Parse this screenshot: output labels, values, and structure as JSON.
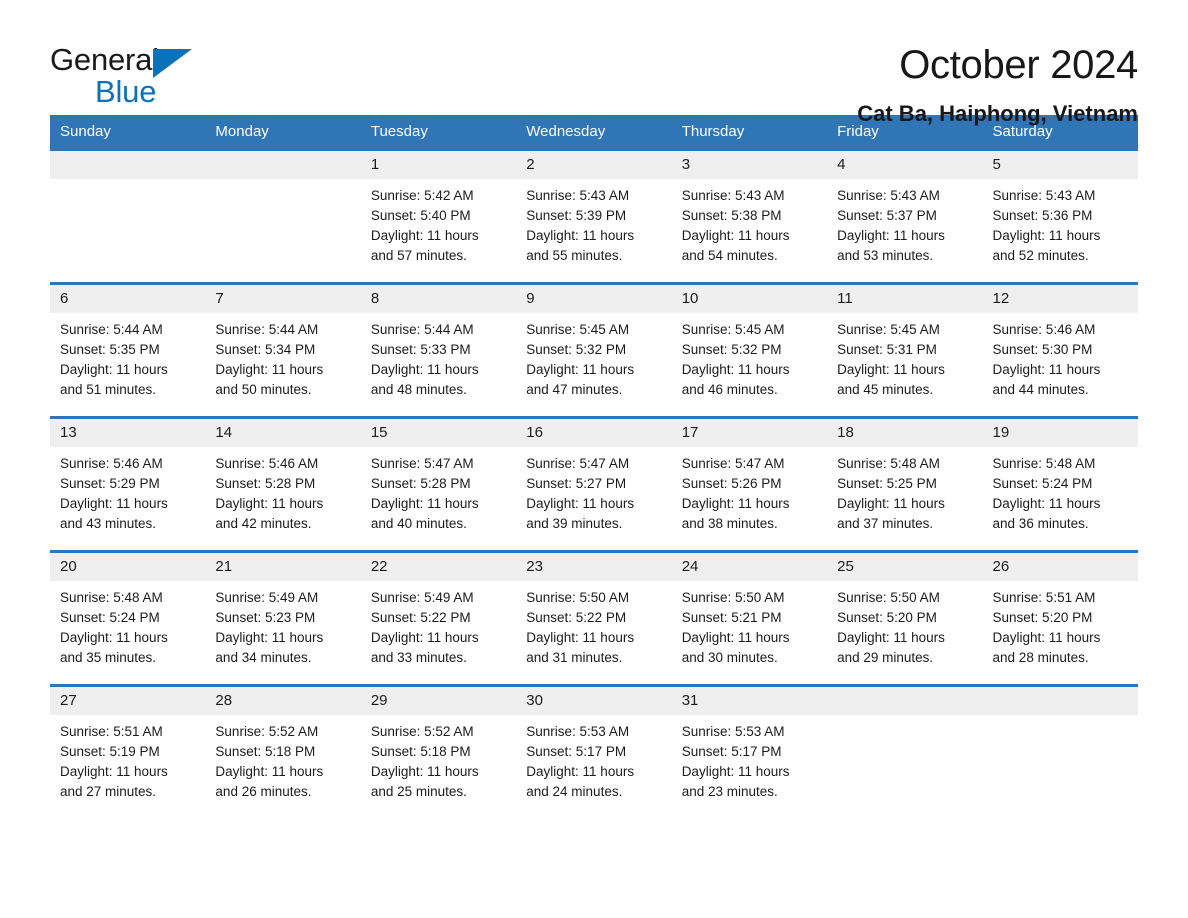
{
  "brand": {
    "word_one": "General",
    "word_two": "Blue",
    "triangle_icon": "brand-triangle-icon",
    "accent_color": "#0b72ba"
  },
  "header": {
    "month_title": "October 2024",
    "location": "Cat Ba, Haiphong, Vietnam"
  },
  "theme": {
    "header_blue": "#3075b5",
    "row_rule_blue": "#2f74b4",
    "day_band_gray": "#efefef",
    "text_color": "#1c1c1c"
  },
  "calendar": {
    "weekday_headers": [
      "Sunday",
      "Monday",
      "Tuesday",
      "Wednesday",
      "Thursday",
      "Friday",
      "Saturday"
    ],
    "weeks": [
      [
        {
          "day": "",
          "detail": ""
        },
        {
          "day": "",
          "detail": ""
        },
        {
          "day": "1",
          "detail": "Sunrise: 5:42 AM\nSunset: 5:40 PM\nDaylight: 11 hours\nand 57 minutes."
        },
        {
          "day": "2",
          "detail": "Sunrise: 5:43 AM\nSunset: 5:39 PM\nDaylight: 11 hours\nand 55 minutes."
        },
        {
          "day": "3",
          "detail": "Sunrise: 5:43 AM\nSunset: 5:38 PM\nDaylight: 11 hours\nand 54 minutes."
        },
        {
          "day": "4",
          "detail": "Sunrise: 5:43 AM\nSunset: 5:37 PM\nDaylight: 11 hours\nand 53 minutes."
        },
        {
          "day": "5",
          "detail": "Sunrise: 5:43 AM\nSunset: 5:36 PM\nDaylight: 11 hours\nand 52 minutes."
        }
      ],
      [
        {
          "day": "6",
          "detail": "Sunrise: 5:44 AM\nSunset: 5:35 PM\nDaylight: 11 hours\nand 51 minutes."
        },
        {
          "day": "7",
          "detail": "Sunrise: 5:44 AM\nSunset: 5:34 PM\nDaylight: 11 hours\nand 50 minutes."
        },
        {
          "day": "8",
          "detail": "Sunrise: 5:44 AM\nSunset: 5:33 PM\nDaylight: 11 hours\nand 48 minutes."
        },
        {
          "day": "9",
          "detail": "Sunrise: 5:45 AM\nSunset: 5:32 PM\nDaylight: 11 hours\nand 47 minutes."
        },
        {
          "day": "10",
          "detail": "Sunrise: 5:45 AM\nSunset: 5:32 PM\nDaylight: 11 hours\nand 46 minutes."
        },
        {
          "day": "11",
          "detail": "Sunrise: 5:45 AM\nSunset: 5:31 PM\nDaylight: 11 hours\nand 45 minutes."
        },
        {
          "day": "12",
          "detail": "Sunrise: 5:46 AM\nSunset: 5:30 PM\nDaylight: 11 hours\nand 44 minutes."
        }
      ],
      [
        {
          "day": "13",
          "detail": "Sunrise: 5:46 AM\nSunset: 5:29 PM\nDaylight: 11 hours\nand 43 minutes."
        },
        {
          "day": "14",
          "detail": "Sunrise: 5:46 AM\nSunset: 5:28 PM\nDaylight: 11 hours\nand 42 minutes."
        },
        {
          "day": "15",
          "detail": "Sunrise: 5:47 AM\nSunset: 5:28 PM\nDaylight: 11 hours\nand 40 minutes."
        },
        {
          "day": "16",
          "detail": "Sunrise: 5:47 AM\nSunset: 5:27 PM\nDaylight: 11 hours\nand 39 minutes."
        },
        {
          "day": "17",
          "detail": "Sunrise: 5:47 AM\nSunset: 5:26 PM\nDaylight: 11 hours\nand 38 minutes."
        },
        {
          "day": "18",
          "detail": "Sunrise: 5:48 AM\nSunset: 5:25 PM\nDaylight: 11 hours\nand 37 minutes."
        },
        {
          "day": "19",
          "detail": "Sunrise: 5:48 AM\nSunset: 5:24 PM\nDaylight: 11 hours\nand 36 minutes."
        }
      ],
      [
        {
          "day": "20",
          "detail": "Sunrise: 5:48 AM\nSunset: 5:24 PM\nDaylight: 11 hours\nand 35 minutes."
        },
        {
          "day": "21",
          "detail": "Sunrise: 5:49 AM\nSunset: 5:23 PM\nDaylight: 11 hours\nand 34 minutes."
        },
        {
          "day": "22",
          "detail": "Sunrise: 5:49 AM\nSunset: 5:22 PM\nDaylight: 11 hours\nand 33 minutes."
        },
        {
          "day": "23",
          "detail": "Sunrise: 5:50 AM\nSunset: 5:22 PM\nDaylight: 11 hours\nand 31 minutes."
        },
        {
          "day": "24",
          "detail": "Sunrise: 5:50 AM\nSunset: 5:21 PM\nDaylight: 11 hours\nand 30 minutes."
        },
        {
          "day": "25",
          "detail": "Sunrise: 5:50 AM\nSunset: 5:20 PM\nDaylight: 11 hours\nand 29 minutes."
        },
        {
          "day": "26",
          "detail": "Sunrise: 5:51 AM\nSunset: 5:20 PM\nDaylight: 11 hours\nand 28 minutes."
        }
      ],
      [
        {
          "day": "27",
          "detail": "Sunrise: 5:51 AM\nSunset: 5:19 PM\nDaylight: 11 hours\nand 27 minutes."
        },
        {
          "day": "28",
          "detail": "Sunrise: 5:52 AM\nSunset: 5:18 PM\nDaylight: 11 hours\nand 26 minutes."
        },
        {
          "day": "29",
          "detail": "Sunrise: 5:52 AM\nSunset: 5:18 PM\nDaylight: 11 hours\nand 25 minutes."
        },
        {
          "day": "30",
          "detail": "Sunrise: 5:53 AM\nSunset: 5:17 PM\nDaylight: 11 hours\nand 24 minutes."
        },
        {
          "day": "31",
          "detail": "Sunrise: 5:53 AM\nSunset: 5:17 PM\nDaylight: 11 hours\nand 23 minutes."
        },
        {
          "day": "",
          "detail": ""
        },
        {
          "day": "",
          "detail": ""
        }
      ]
    ]
  }
}
